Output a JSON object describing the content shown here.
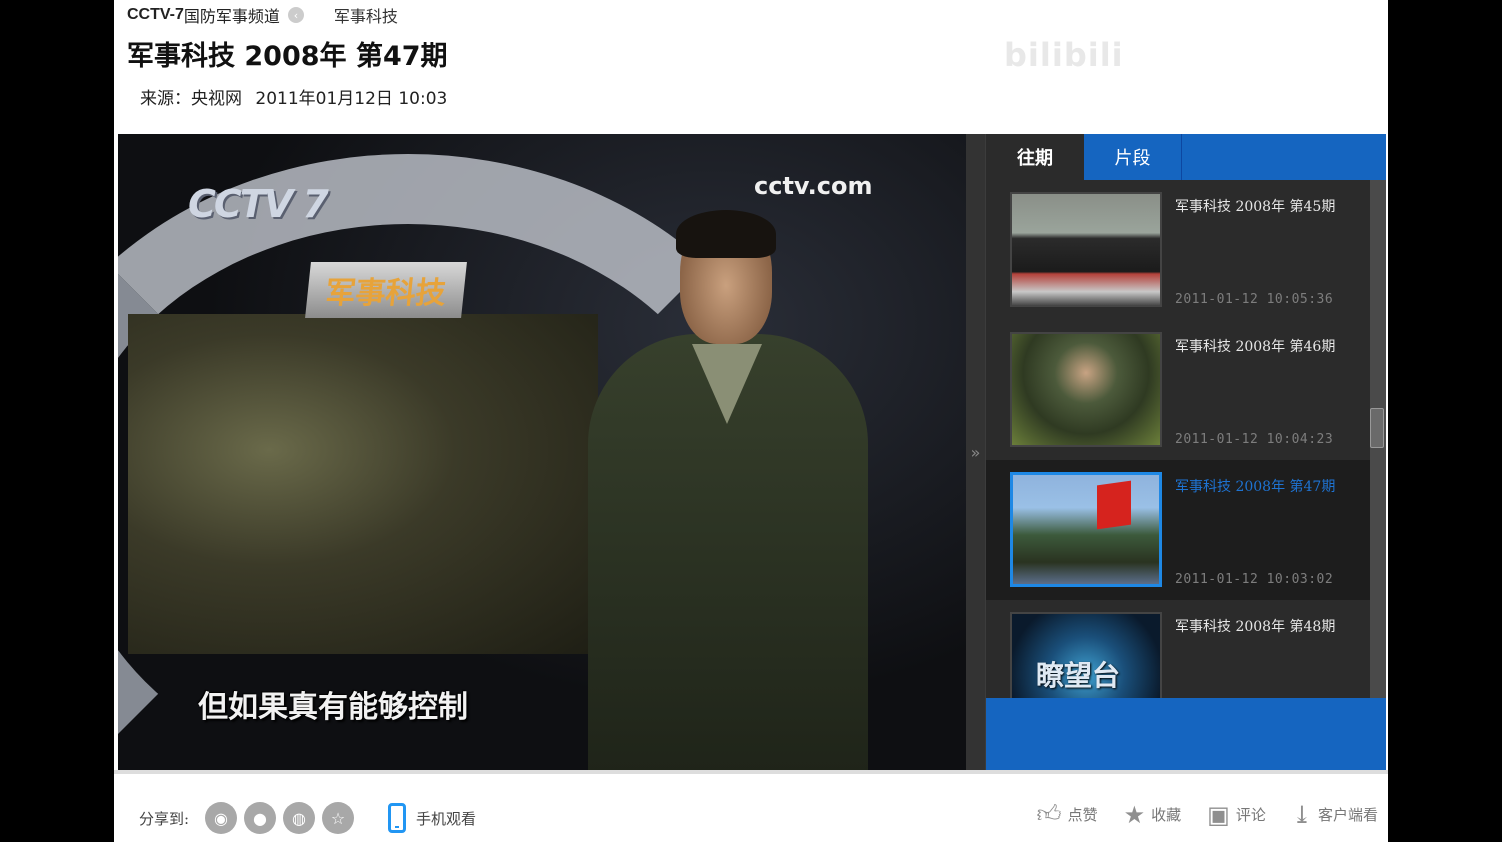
{
  "header": {
    "channel": "CCTV-7",
    "channel_cn": "国防军事频道",
    "column": "军事科技",
    "title": "军事科技 2008年 第47期",
    "source": "来源：央视网",
    "datetime": "2011年01月12日 10:03"
  },
  "video": {
    "station_logo": "CCTV 7",
    "program_logo": "军事科技",
    "web_logo": "cctv.com",
    "subtitle": "但如果真有能够控制"
  },
  "panel": {
    "tabs": [
      {
        "label": "往期",
        "active": true
      },
      {
        "label": "片段",
        "active": false
      }
    ],
    "episodes": [
      {
        "title": "军事科技  2008年  第45期",
        "time": "2011-01-12  10:05:36",
        "active": false
      },
      {
        "title": "军事科技  2008年  第46期",
        "time": "2011-01-12  10:04:23",
        "active": false
      },
      {
        "title": "军事科技  2008年  第47期",
        "time": "2011-01-12  10:03:02",
        "active": true
      },
      {
        "title": "军事科技  2008年  第48期",
        "time": "",
        "active": false
      }
    ],
    "toggle_icon": "double-chevron-right-icon"
  },
  "footer": {
    "share_label": "分享到:",
    "share_icons": [
      "weibo-icon",
      "qq-icon",
      "wechat-icon",
      "star-icon"
    ],
    "mobile_label": "手机观看",
    "actions": [
      {
        "label": "点赞",
        "icon": "thumbs-up-icon"
      },
      {
        "label": "收藏",
        "icon": "star-icon"
      },
      {
        "label": "评论",
        "icon": "comment-icon"
      },
      {
        "label": "客户端看",
        "icon": "download-icon"
      }
    ]
  },
  "colors": {
    "accent_blue": "#1565c0",
    "active_title": "#1e73d2",
    "panel_bg": "#2b2b2b"
  }
}
